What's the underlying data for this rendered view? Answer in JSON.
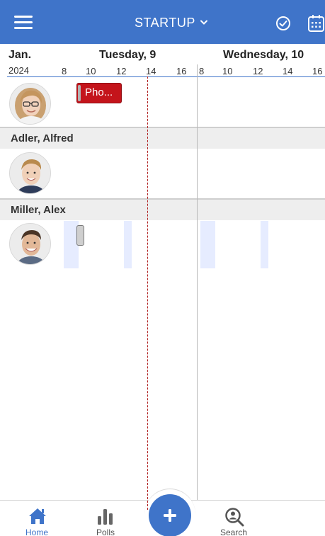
{
  "header": {
    "title": "STARTUP",
    "menu_icon": "hamburger-menu-icon",
    "dropdown_icon": "chevron-down-icon",
    "check_icon": "check-circle-icon",
    "calendar_icon": "calendar-icon",
    "background_color": "#3f74c9"
  },
  "timeline": {
    "month": "Jan.",
    "year": "2024",
    "days": [
      {
        "label": "Tuesday, 9",
        "hours": [
          "8",
          "10",
          "12",
          "14",
          "16"
        ]
      },
      {
        "label": "Wednesday, 10",
        "hours": [
          "8",
          "10",
          "12",
          "14",
          "16"
        ]
      }
    ],
    "current_time_line_color": "#b02020"
  },
  "rows": [
    {
      "name": "",
      "avatar": "woman-with-glasses-avatar",
      "events": [
        {
          "label": "Pho...",
          "color": "#c4141b"
        }
      ]
    },
    {
      "name": "Adler, Alfred",
      "avatar": "young-man-avatar",
      "events": []
    },
    {
      "name": "Miller, Alex",
      "avatar": "smiling-man-avatar",
      "events": [
        {
          "label": "",
          "color": "#cfcfcf"
        }
      ],
      "availability_color": "#e6ecff"
    }
  ],
  "bottom_nav": {
    "items": [
      {
        "label": "Home",
        "icon": "home-icon",
        "active": true
      },
      {
        "label": "Polls",
        "icon": "bar-chart-icon",
        "active": false
      },
      {
        "label": "Search",
        "icon": "person-search-icon",
        "active": false
      }
    ],
    "add_button_icon": "plus-icon",
    "active_color": "#3f74c9"
  }
}
